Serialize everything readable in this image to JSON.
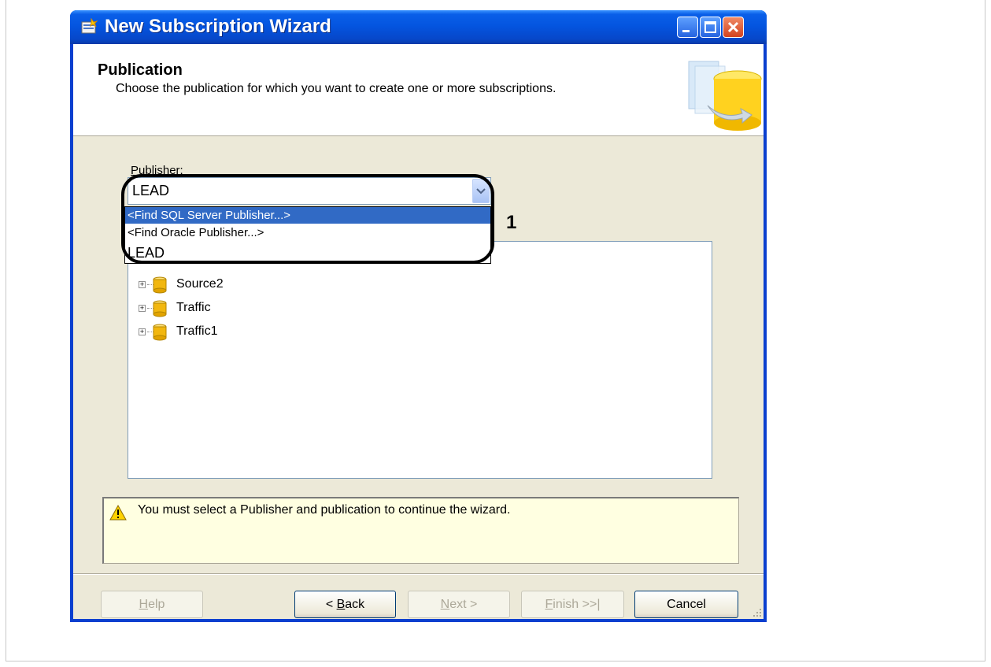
{
  "window": {
    "title": "New Subscription Wizard"
  },
  "header": {
    "title": "Publication",
    "subtitle": "Choose the publication for which you want to create one or more subscriptions."
  },
  "publisher": {
    "label_first": "P",
    "label_rest": "ublisher:",
    "selected": "LEAD",
    "options": [
      "<Find SQL Server Publisher...>",
      "<Find Oracle Publisher...>",
      "LEAD"
    ]
  },
  "callout": {
    "number": "1"
  },
  "tree": {
    "items": [
      {
        "label": "Source2"
      },
      {
        "label": "Traffic"
      },
      {
        "label": "Traffic1"
      }
    ]
  },
  "message": {
    "text": "You must select a Publisher and publication to continue the wizard."
  },
  "buttons": {
    "help": {
      "u": "H",
      "rest": "elp"
    },
    "back": {
      "pre": "< ",
      "u": "B",
      "rest": "ack"
    },
    "next": {
      "u": "N",
      "rest": "ext >"
    },
    "finish": {
      "u": "F",
      "rest": "inish >>|"
    },
    "cancel": "Cancel"
  }
}
